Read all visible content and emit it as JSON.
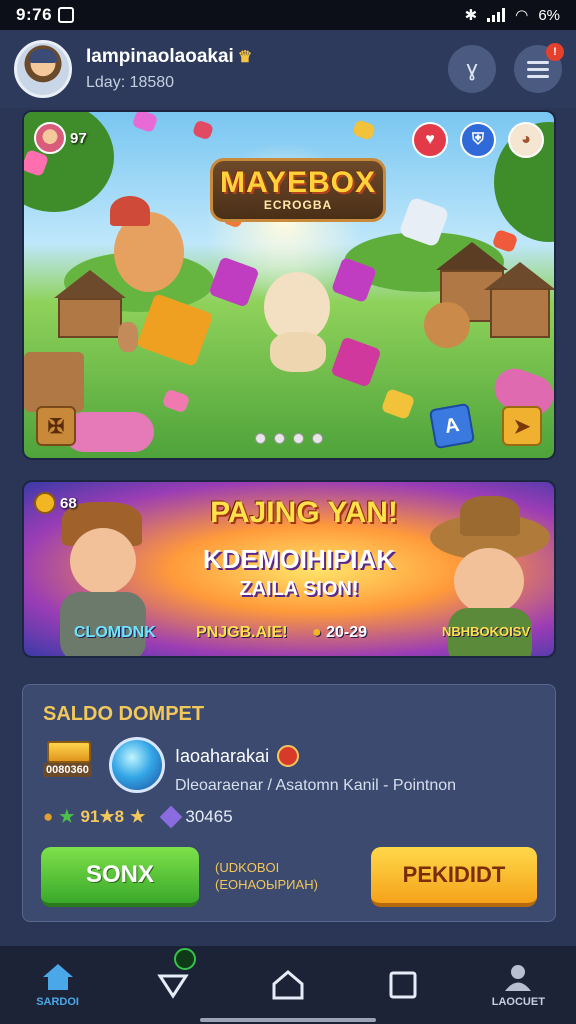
{
  "status_bar": {
    "time": "9:76",
    "battery": "6%"
  },
  "header": {
    "username": "Iampinaolaoakai",
    "level": "Lday: 18580"
  },
  "banner1": {
    "player_count": "97",
    "logo_title": "MAYEBOX",
    "logo_subtitle": "ECROGBA"
  },
  "banner2": {
    "coins": "68",
    "title": "PAJING YAN!",
    "subtitle": "KDEMOIHIPIAK",
    "subtitle2": "ZAILA SION!",
    "left_label": "CLOMDNK",
    "center_label": "PNJGB.AIE!",
    "center_value": "20-29",
    "right_label": "NBHBOKOISV"
  },
  "wallet": {
    "title": "SALDO DOMPET",
    "gold_tag": "0080360",
    "name": "Iaoaharakai",
    "description": "Dleoaraenar / Asatomn Kanil - Pointnon",
    "stat1": "91★8",
    "stat2": "30465",
    "button_left": "SONX",
    "middle_line1": "(UDKOBOI",
    "middle_line2": "(ЕОНАОЫРИАН)",
    "button_right": "PEKIDIDT"
  },
  "navbar": {
    "home_label": "SARDOI",
    "account_label": "LAOCUET"
  },
  "colors": {
    "bg": "#2b3656",
    "accent_gold": "#f2c75c",
    "green": "#3aa92a",
    "orange": "#f5a31a"
  }
}
